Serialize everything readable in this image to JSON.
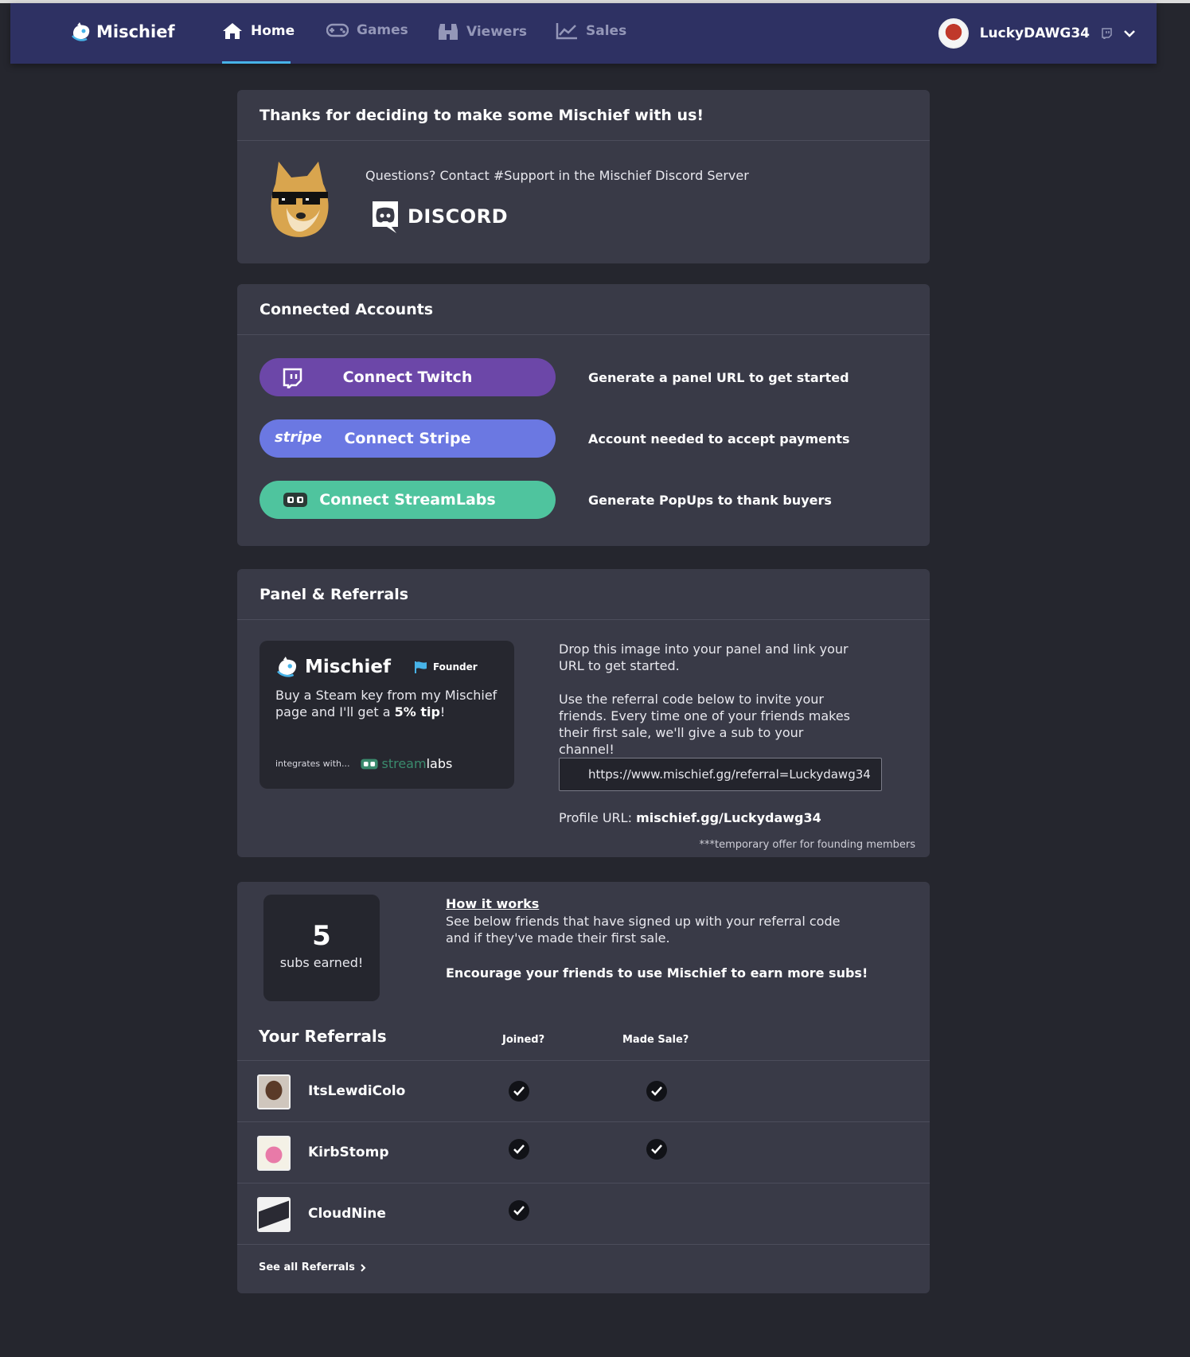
{
  "nav": {
    "brand": "Mischief",
    "items": [
      {
        "label": "Home",
        "icon": "home-icon",
        "active": true
      },
      {
        "label": "Games",
        "icon": "gamepad-icon",
        "active": false
      },
      {
        "label": "Viewers",
        "icon": "binoculars-icon",
        "active": false
      },
      {
        "label": "Sales",
        "icon": "chart-line-icon",
        "active": false
      }
    ],
    "username": "LuckyDAWG34",
    "accent_color": "#47b3e8"
  },
  "welcome": {
    "title": "Thanks for deciding to make some Mischief with us!",
    "support_text": "Questions? Contact #Support in the Mischief Discord Server",
    "discord_label": "DISCORD"
  },
  "accounts": {
    "title": "Connected Accounts",
    "items": [
      {
        "button": "Connect Twitch",
        "description": "Generate a panel URL to get started",
        "color": "#6c47a8"
      },
      {
        "button": "Connect Stripe",
        "icon_text": "stripe",
        "description": "Account needed to accept payments",
        "color": "#6b78e2"
      },
      {
        "button": "Connect StreamLabs",
        "description": "Generate PopUps to thank buyers",
        "color": "#4fc49e"
      }
    ]
  },
  "panel": {
    "title": "Panel & Referrals",
    "image": {
      "brand": "Mischief",
      "badge": "Founder",
      "desc_pre": "Buy a Steam key from my Mischief page and I'll get a ",
      "desc_bold": "5% tip",
      "desc_post": "!",
      "integrates": "integrates with...",
      "streamlabs_a": "stream",
      "streamlabs_b": "labs"
    },
    "instructions": "Drop this image into your panel and link your URL to get started.",
    "referral_info": "Use the referral code below to invite your friends. Every time one of your friends makes their first sale, we'll give a sub to your channel!",
    "referral_url": "https://www.mischief.gg/referral=Luckydawg34",
    "profile_label": "Profile URL: ",
    "profile_url": "mischief.gg/Luckydawg34",
    "note": "***temporary offer for founding members"
  },
  "referrals": {
    "subs_count": "5",
    "subs_label": "subs earned!",
    "how_title": "How it works",
    "how_desc": "See below friends that have signed up with your referral code and if they've made their first sale.",
    "encourage": "Encourage your friends to use Mischief to earn more subs!",
    "title": "Your Referrals",
    "col_joined": "Joined?",
    "col_sale": "Made Sale?",
    "rows": [
      {
        "name": "ItsLewdiColo",
        "joined": true,
        "sale": true
      },
      {
        "name": "KirbStomp",
        "joined": true,
        "sale": true
      },
      {
        "name": "CloudNine",
        "joined": true,
        "sale": false
      }
    ],
    "see_all": "See all Referrals"
  }
}
